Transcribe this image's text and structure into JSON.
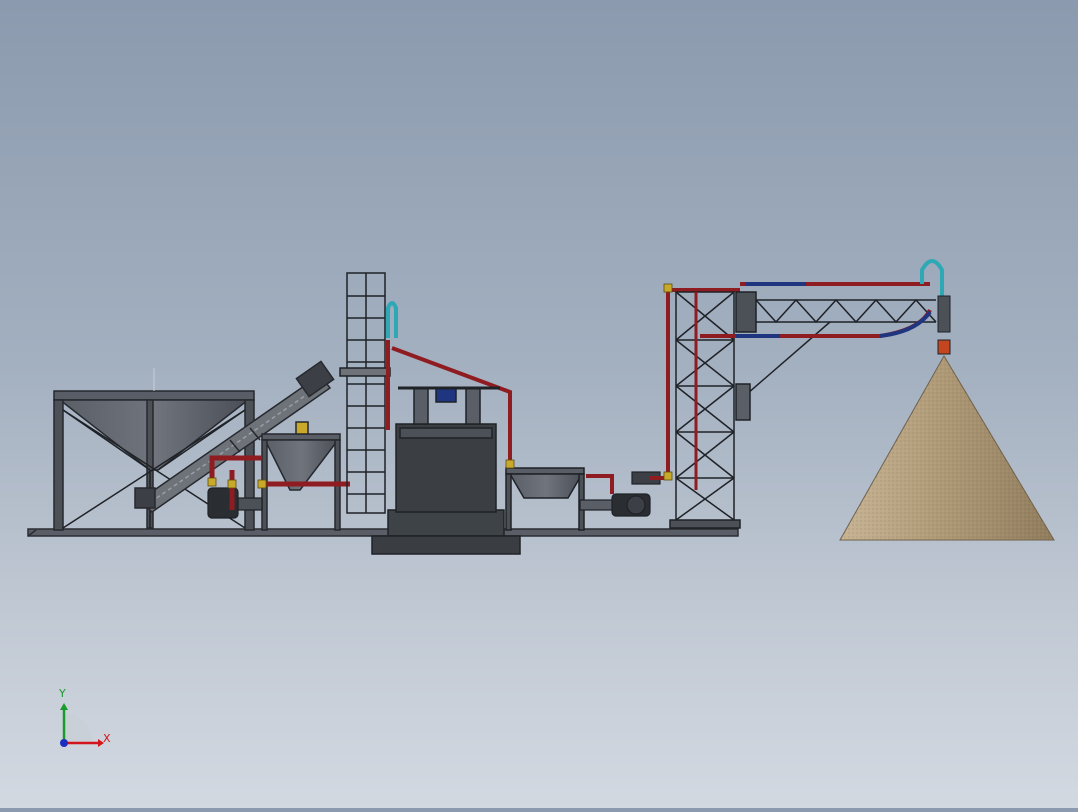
{
  "triad": {
    "x_label": "X",
    "y_label": "Y",
    "x_color": "#d4141c",
    "y_color": "#1a9a2c",
    "z_color": "#1d2fc0"
  },
  "colors": {
    "steel": "#4a4e55",
    "steel_dark": "#2f3238",
    "pipe_red": "#8e1c20",
    "pipe_blue": "#1f3580",
    "pipe_cyan": "#2ea8b5",
    "fitting_yellow": "#c9a92a",
    "sand": "#b5a180",
    "base": "#3b3f44",
    "nozzle": "#c4451e"
  },
  "components": [
    "hopper-tank",
    "screw-conveyor",
    "small-hopper",
    "ladder-tower",
    "mixing-tank",
    "metering-trough",
    "pump-unit",
    "support-tower",
    "boom-arm",
    "sand-pile"
  ]
}
